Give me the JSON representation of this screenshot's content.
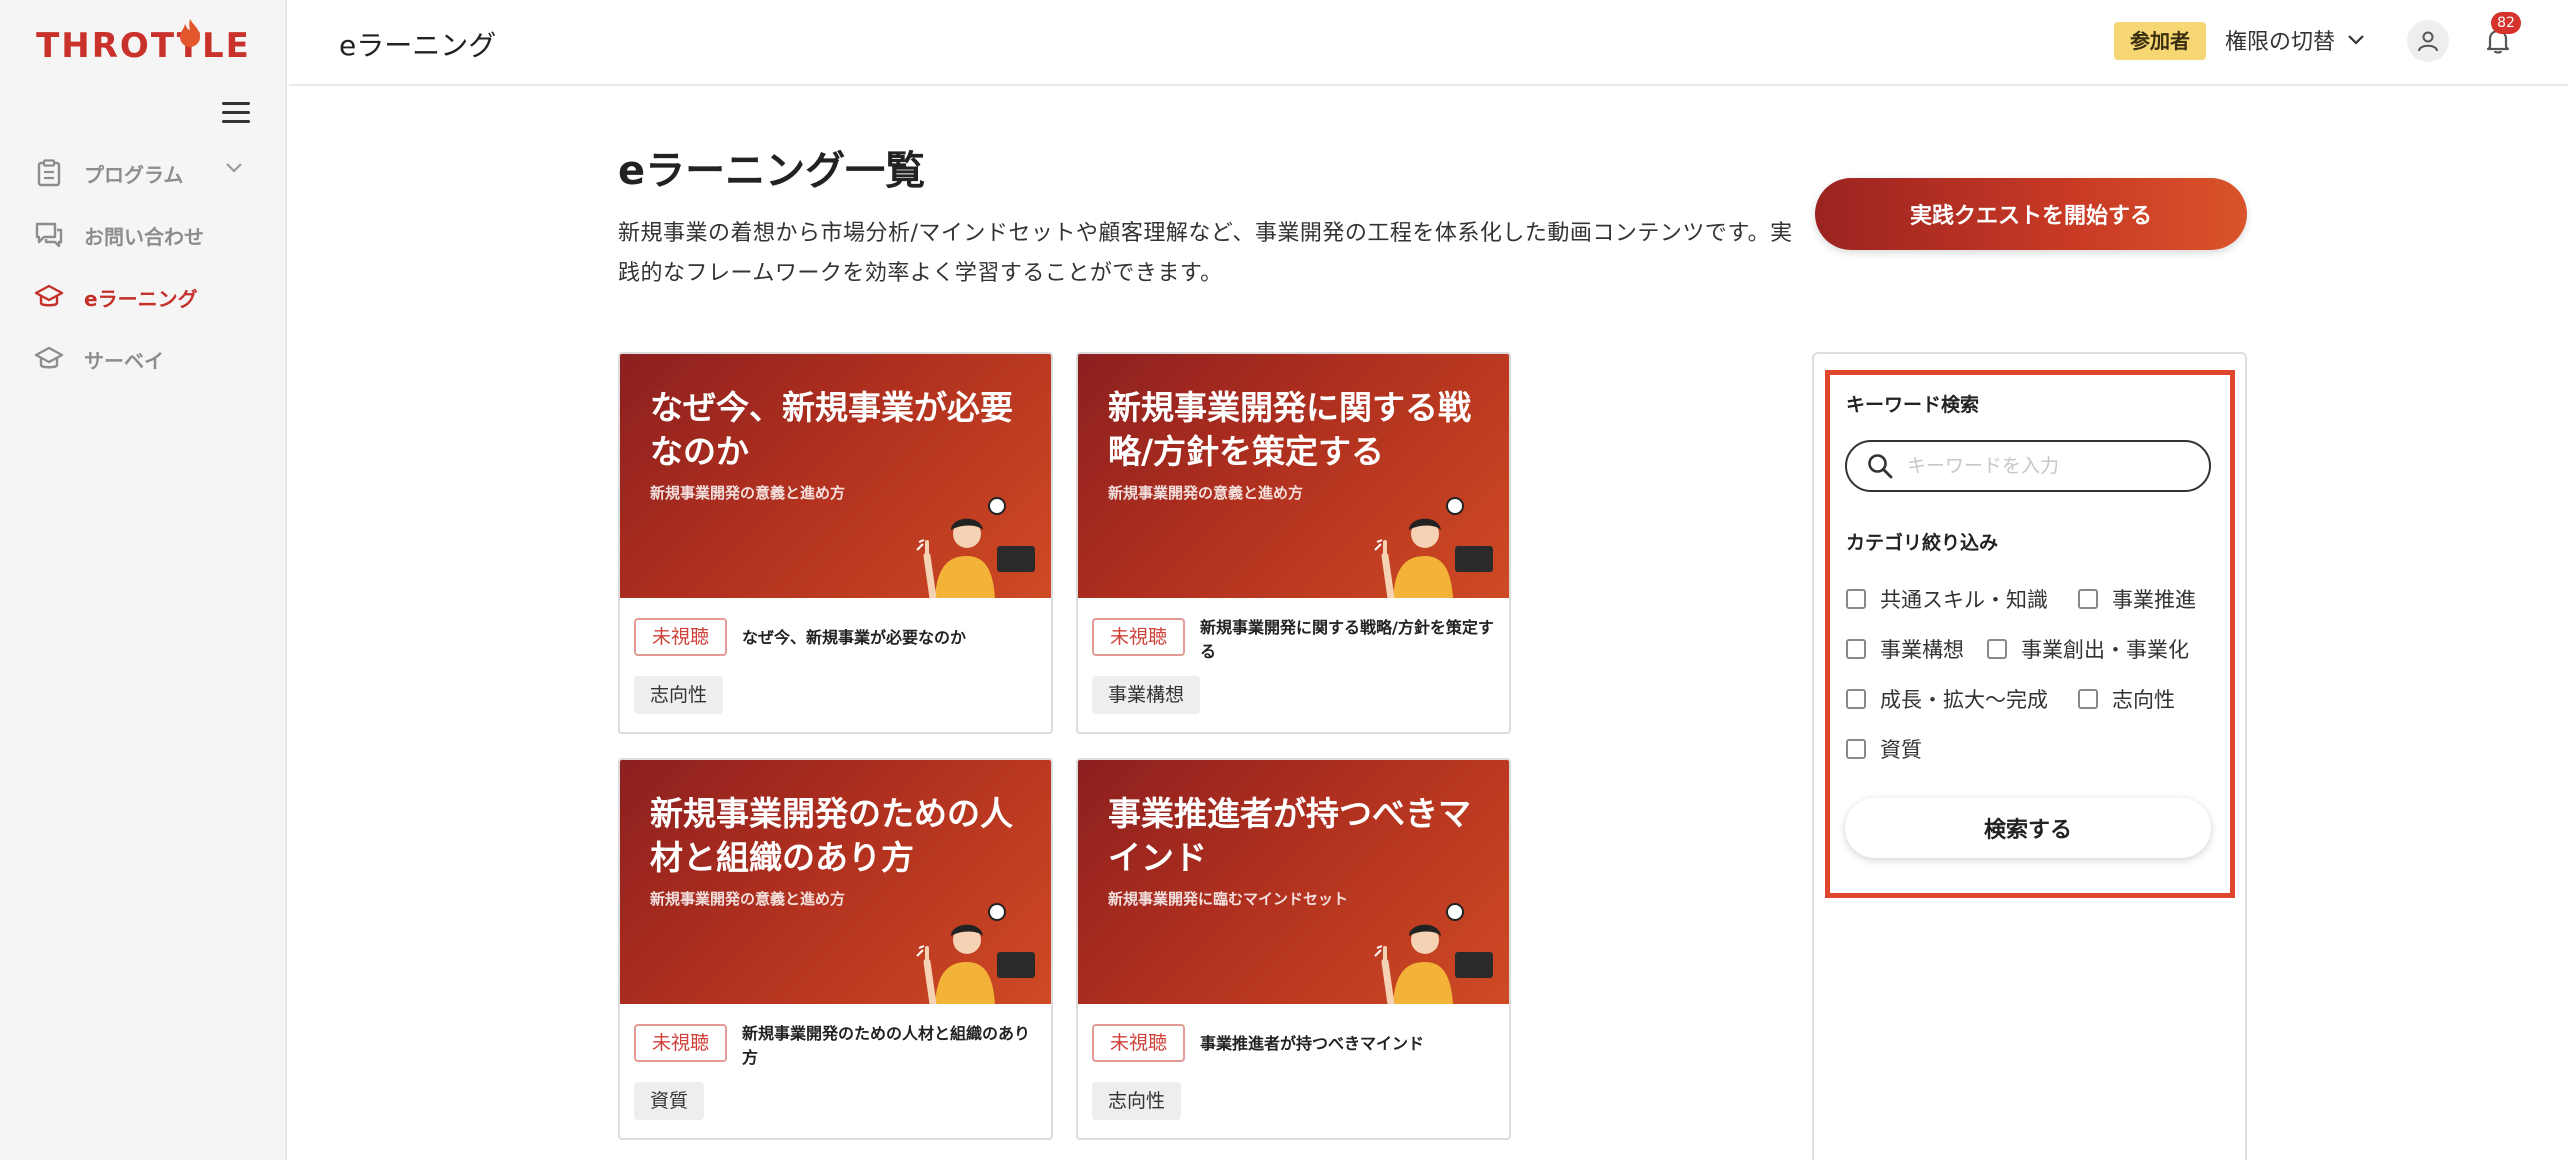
{
  "app": {
    "logo_text": "THROTTLE"
  },
  "sidebar": {
    "items": [
      {
        "label": "プログラム",
        "icon": "clipboard-icon",
        "has_chevron": true
      },
      {
        "label": "お問い合わせ",
        "icon": "chat-icon"
      },
      {
        "label": "eラーニング",
        "icon": "graduation-cap-icon",
        "active": true
      },
      {
        "label": "サーベイ",
        "icon": "graduation-cap-icon"
      }
    ]
  },
  "header": {
    "title": "eラーニング",
    "role_badge": "参加者",
    "role_switch": "権限の切替",
    "notification_count": "82"
  },
  "main": {
    "title": "eラーニング一覧",
    "description": "新規事業の着想から市場分析/マインドセットや顧客理解など、事業開発の工程を体系化した動画コンテンツです。実践的なフレームワークを効率よく学習することができます。",
    "quest_button": "実践クエストを開始する"
  },
  "cards": [
    {
      "thumb_title": "なぜ今、新規事業が必要なのか",
      "thumb_subtitle": "新規事業開発の意義と進め方",
      "status": "未視聴",
      "title": "なぜ今、新規事業が必要なのか",
      "category": "志向性"
    },
    {
      "thumb_title": "新規事業開発に関する戦略/方針を策定する",
      "thumb_subtitle": "新規事業開発の意義と進め方",
      "status": "未視聴",
      "title": "新規事業開発に関する戦略/方針を策定する",
      "category": "事業構想"
    },
    {
      "thumb_title": "新規事業開発のための人材と組織のあり方",
      "thumb_subtitle": "新規事業開発の意義と進め方",
      "status": "未視聴",
      "title": "新規事業開発のための人材と組織のあり方",
      "category": "資質"
    },
    {
      "thumb_title": "事業推進者が持つべきマインド",
      "thumb_subtitle": "新規事業開発に臨むマインドセット",
      "status": "未視聴",
      "title": "事業推進者が持つべきマインド",
      "category": "志向性"
    }
  ],
  "filter": {
    "keyword_label": "キーワード検索",
    "keyword_placeholder": "キーワードを入力",
    "keyword_value": "",
    "category_label": "カテゴリ絞り込み",
    "categories": [
      "共通スキル・知識",
      "事業推進",
      "事業構想",
      "事業創出・事業化",
      "成長・拡大〜完成",
      "志向性",
      "資質"
    ],
    "search_button": "検索する"
  },
  "colors": {
    "brand": "#c9322a",
    "accent": "#e0452e",
    "badge_yellow": "#f7d774"
  }
}
